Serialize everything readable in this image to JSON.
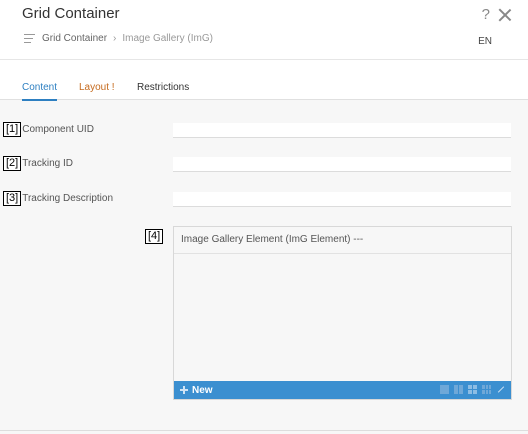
{
  "header": {
    "title": "Grid Container",
    "help_icon": "?",
    "breadcrumb": {
      "parent": "Grid Container",
      "separator": "›",
      "current": "Image Gallery (ImG)"
    },
    "language": "EN"
  },
  "tabs": [
    {
      "label": "Content",
      "active": true
    },
    {
      "label": "Layout !",
      "warning": true
    },
    {
      "label": "Restrictions"
    }
  ],
  "fields": [
    {
      "badge": "[1]",
      "label": "Component UID",
      "value": ""
    },
    {
      "badge": "[2]",
      "label": "Tracking ID",
      "value": ""
    },
    {
      "badge": "[3]",
      "label": "Tracking Description",
      "value": ""
    }
  ],
  "gallery": {
    "badge": "[4]",
    "header": "Image Gallery Element (ImG Element) ---",
    "new_label": "New",
    "toolbar_color": "#3b8fd0"
  },
  "colors": {
    "accent": "#2d7fc1",
    "warning": "#c66b1e"
  }
}
